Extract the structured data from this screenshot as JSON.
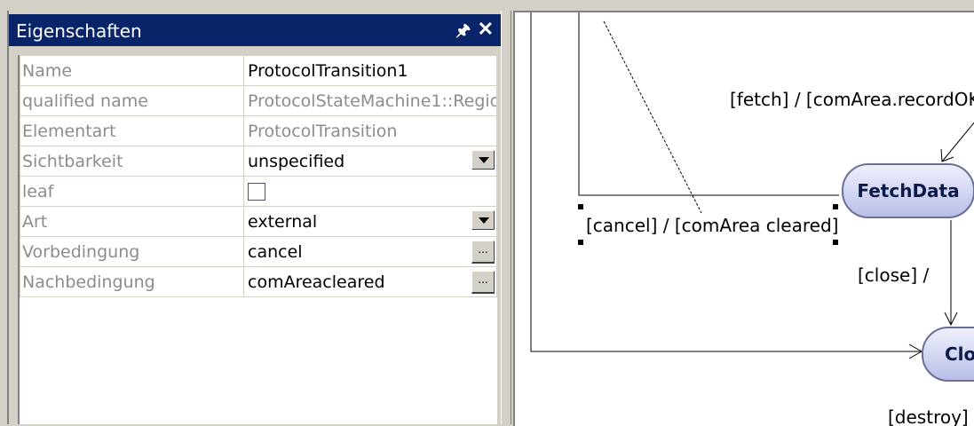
{
  "properties_panel": {
    "title": "Eigenschaften",
    "pin_icon": "pin-icon",
    "close_icon": "close-icon",
    "rows": [
      {
        "label": "Name",
        "value": "ProtocolTransition1",
        "editor": "text",
        "readonly": false
      },
      {
        "label": "qualified name",
        "value": "ProtocolStateMachine1::Regio",
        "editor": "text",
        "readonly": true
      },
      {
        "label": "Elementart",
        "value": "ProtocolTransition",
        "editor": "text",
        "readonly": true
      },
      {
        "label": "Sichtbarkeit",
        "value": "unspecified",
        "editor": "dropdown",
        "readonly": false
      },
      {
        "label": "leaf",
        "value": "",
        "editor": "checkbox",
        "checked": false
      },
      {
        "label": "Art",
        "value": "external",
        "editor": "dropdown",
        "readonly": false
      },
      {
        "label": "Vorbedingung",
        "value": "cancel",
        "editor": "ellipsis",
        "readonly": false
      },
      {
        "label": "Nachbedingung",
        "value": "comAreacleared",
        "editor": "ellipsis",
        "readonly": false
      }
    ],
    "ellipsis_label": "..."
  },
  "diagram": {
    "labels": {
      "fetch": "[fetch] / [comArea.recordOK",
      "cancel": "[cancel] / [comArea cleared]",
      "close": "[close] /",
      "destroy": "[destroy] /"
    },
    "states": {
      "fetchdata": "FetchData",
      "closed": "Clo"
    }
  },
  "colors": {
    "titlebar": "#0a246a",
    "panel_bg": "#d4d0c8",
    "state_fill": "#b9bee9",
    "state_border": "#6a6f98"
  }
}
